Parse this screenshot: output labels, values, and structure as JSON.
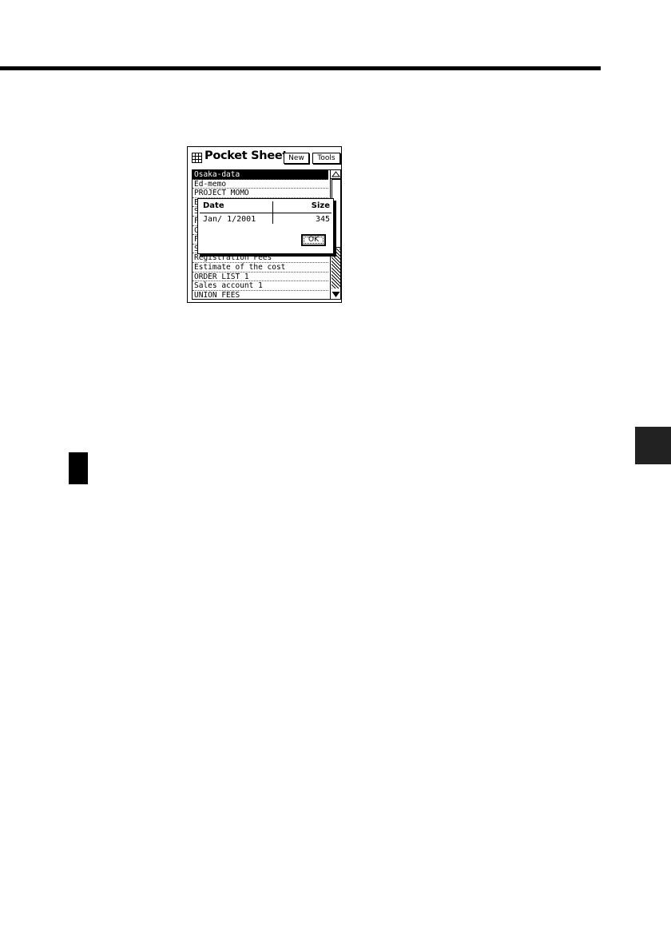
{
  "app": {
    "title": "Pocket Sheet",
    "icon": "spreadsheet-grid-icon"
  },
  "toolbar": {
    "new_label": "New",
    "tools_label": "Tools"
  },
  "file_list": {
    "selected_index": 0,
    "items": [
      "Osaka-data",
      "Ed-memo",
      "PROJECT MOMO",
      "E",
      "S",
      "F",
      "C",
      "F",
      "S",
      "Registration Fees",
      "Estimate of the cost",
      "ORDER LIST 1",
      "Sales account 1",
      "UNION FEES"
    ]
  },
  "dialog": {
    "date_header": "Date",
    "size_header": "Size",
    "date_value": "Jan/ 1/2001",
    "size_value": "345",
    "ok_label": "OK"
  }
}
